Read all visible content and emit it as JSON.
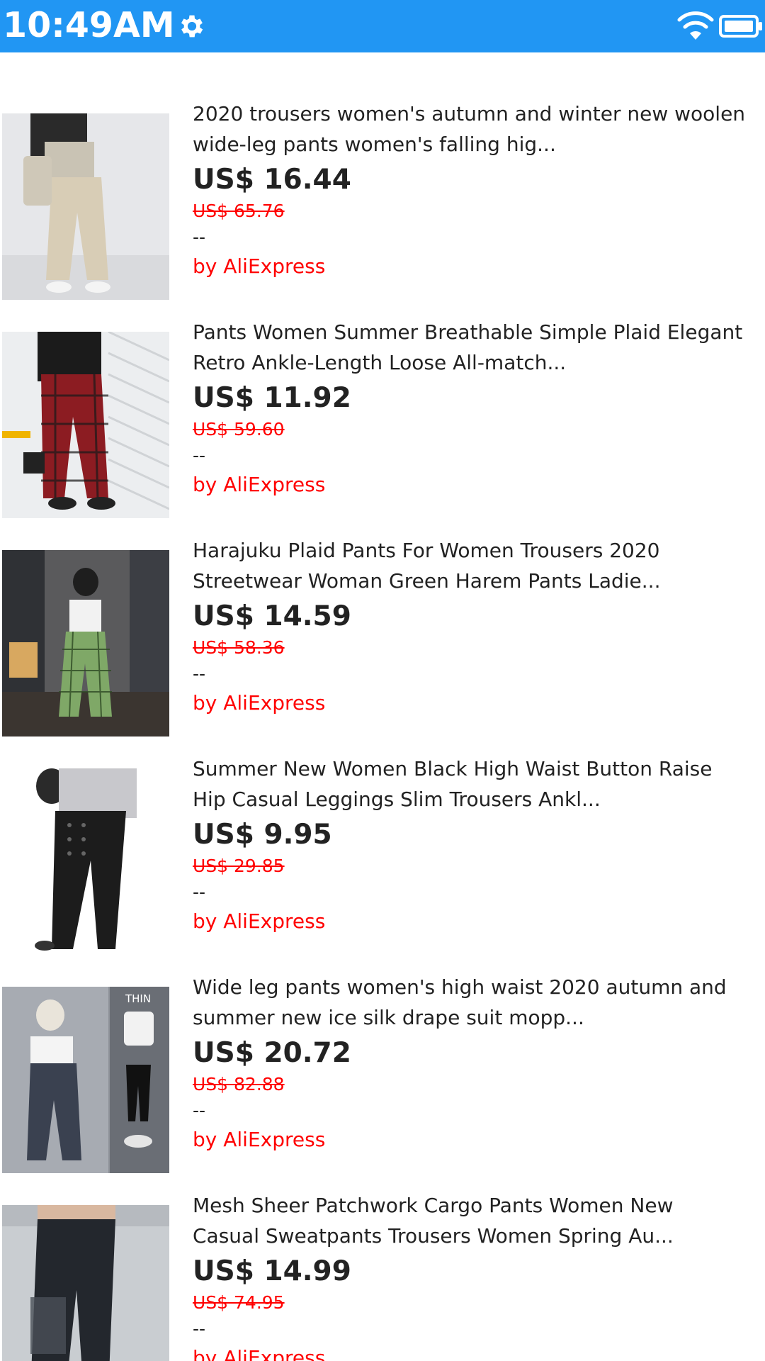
{
  "status_bar": {
    "time": "10:49AM",
    "color": "#2196F3",
    "icons": [
      "gear-icon",
      "wifi-icon",
      "battery-icon"
    ]
  },
  "products": [
    {
      "title_line1": "2020 trousers women's autumn and winter new woolen",
      "title_line2": "wide-leg pants women's falling hig...",
      "price": "US$ 16.44",
      "original_price": "US$ 65.76",
      "rating": "--",
      "seller": "by AliExpress"
    },
    {
      "title_line1": "Pants Women Summer Breathable Simple Plaid Elegant",
      "title_line2": "Retro Ankle-Length Loose All-match...",
      "price": "US$ 11.92",
      "original_price": "US$ 59.60",
      "rating": "--",
      "seller": "by AliExpress"
    },
    {
      "title_line1": "Harajuku Plaid Pants For Women Trousers 2020",
      "title_line2": "Streetwear Woman Green Harem Pants Ladie...",
      "price": "US$ 14.59",
      "original_price": "US$ 58.36",
      "rating": "--",
      "seller": "by AliExpress"
    },
    {
      "title_line1": "Summer New Women Black High Waist Button Raise",
      "title_line2": "Hip Casual Leggings Slim Trousers Ankl...",
      "price": "US$ 9.95",
      "original_price": "US$ 29.85",
      "rating": "--",
      "seller": "by AliExpress"
    },
    {
      "title_line1": "Wide leg pants women's high waist 2020 autumn and",
      "title_line2": "summer new ice silk drape suit mopp...",
      "price": "US$ 20.72",
      "original_price": "US$ 82.88",
      "rating": "--",
      "seller": "by AliExpress",
      "image_text": "THIN"
    },
    {
      "title_line1": "Mesh Sheer Patchwork Cargo Pants Women New",
      "title_line2": "Casual Sweatpants Trousers Women Spring Au...",
      "price": "US$ 14.99",
      "original_price": "US$ 74.95",
      "rating": "--",
      "seller": "by AliExpress"
    }
  ]
}
